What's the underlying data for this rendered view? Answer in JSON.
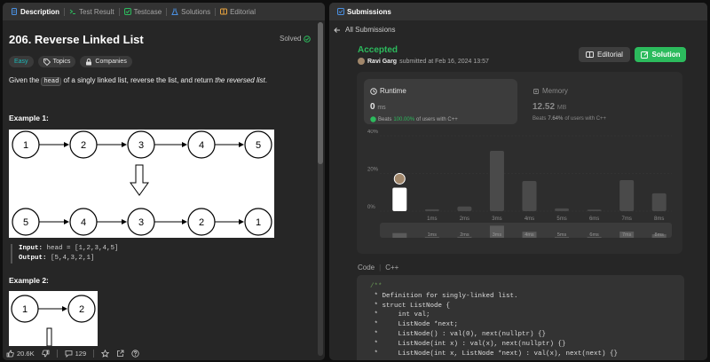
{
  "left_tabs": [
    {
      "label": "Description",
      "icon": "document-icon",
      "active": true
    },
    {
      "label": "Test Result",
      "icon": "terminal-icon",
      "active": false
    },
    {
      "label": "Testcase",
      "icon": "checkbox-icon",
      "active": false
    },
    {
      "label": "Solutions",
      "icon": "flask-icon",
      "active": false
    },
    {
      "label": "Editorial",
      "icon": "book-icon",
      "active": false
    }
  ],
  "problem": {
    "title": "206. Reverse Linked List",
    "solved_label": "Solved",
    "difficulty": "Easy",
    "topics_label": "Topics",
    "companies_label": "Companies",
    "desc_pre": "Given the ",
    "desc_code": "head",
    "desc_mid": " of a singly linked list, reverse the list, and return ",
    "desc_em": "the reversed list",
    "desc_end": ".",
    "example1_title": "Example 1:",
    "example1_top": [
      "1",
      "2",
      "3",
      "4",
      "5"
    ],
    "example1_bottom": [
      "5",
      "4",
      "3",
      "2",
      "1"
    ],
    "input_label": "Input:",
    "input_value": " head = [1,2,3,4,5]",
    "output_label": "Output:",
    "output_value": " [5,4,3,2,1]",
    "example2_title": "Example 2:",
    "example2_nodes": [
      "1",
      "2"
    ]
  },
  "bottom_bar": {
    "likes": "20.6K",
    "comments": "129"
  },
  "right_tab": {
    "label": "Submissions",
    "icon": "submissions-icon"
  },
  "back_label": "All Submissions",
  "status": "Accepted",
  "user": {
    "name": "Ravi Garg",
    "submitted": "submitted at Feb 16, 2024 13:57"
  },
  "buttons": {
    "editorial": "Editorial",
    "solution": "Solution"
  },
  "runtime": {
    "label": "Runtime",
    "value": "0",
    "unit": "ms",
    "beats_pre": "Beats",
    "beats_pct": "100.00%",
    "beats_post": "of users with C++"
  },
  "memory": {
    "label": "Memory",
    "value": "12.52",
    "unit": "MB",
    "beats_pre": "Beats",
    "beats_pct": "7.64%",
    "beats_post": "of users with C++"
  },
  "chart_data": {
    "type": "bar",
    "categories": [
      "0ms",
      "1ms",
      "2ms",
      "3ms",
      "4ms",
      "5ms",
      "6ms",
      "7ms",
      "8ms"
    ],
    "values": [
      12.5,
      1,
      2.5,
      32,
      16,
      1.5,
      0.8,
      16.5,
      9.5
    ],
    "yticks": [
      "0%",
      "20%",
      "40%"
    ],
    "ylim": [
      0,
      40
    ],
    "highlight_index": 0,
    "axis_labels": [
      "1ms",
      "2ms",
      "3ms",
      "4ms",
      "5ms",
      "6ms",
      "7ms",
      "8ms"
    ],
    "highlight_color": "#ffffff",
    "bar_color": "#4a4a4a"
  },
  "code": {
    "label": "Code",
    "language": "C++",
    "lines": [
      {
        "t": "/**",
        "c": true
      },
      {
        "t": " * Definition for singly-linked list.",
        "c": false
      },
      {
        "t": " * struct ListNode {",
        "c": false
      },
      {
        "t": " *     int val;",
        "c": false
      },
      {
        "t": " *     ListNode *next;",
        "c": false
      },
      {
        "t": " *     ListNode() : val(0), next(nullptr) {}",
        "c": false
      },
      {
        "t": " *     ListNode(int x) : val(x), next(nullptr) {}",
        "c": false
      },
      {
        "t": " *     ListNode(int x, ListNode *next) : val(x), next(next) {}",
        "c": false
      }
    ]
  }
}
